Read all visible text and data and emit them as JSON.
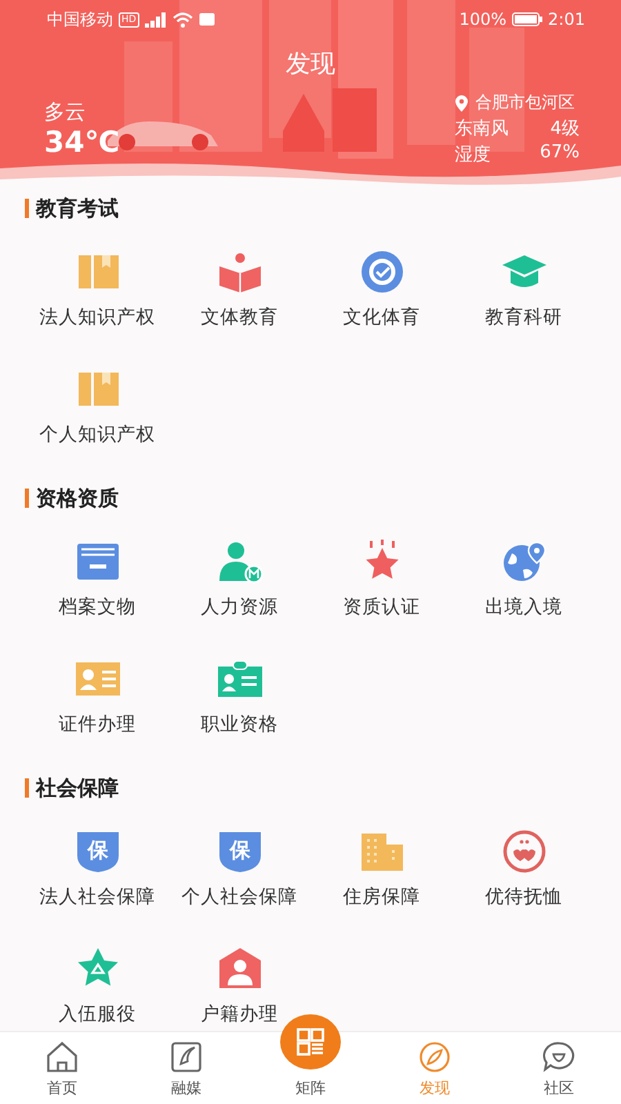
{
  "status_bar": {
    "carrier": "中国移动",
    "network_badge": "HD",
    "battery_text": "100%",
    "time": "2:01"
  },
  "header": {
    "title": "发现",
    "weather": {
      "condition": "多云",
      "temperature": "34℃",
      "location": "合肥市包河区",
      "wind_label": "东南风",
      "wind_value": "4级",
      "humidity_label": "湿度",
      "humidity_value": "67%"
    }
  },
  "sections": [
    {
      "title": "教育考试",
      "items": [
        {
          "label": "法人知识产权"
        },
        {
          "label": "文体教育"
        },
        {
          "label": "文化体育"
        },
        {
          "label": "教育科研"
        },
        {
          "label": "个人知识产权"
        }
      ]
    },
    {
      "title": "资格资质",
      "items": [
        {
          "label": "档案文物"
        },
        {
          "label": "人力资源"
        },
        {
          "label": "资质认证"
        },
        {
          "label": "出境入境"
        },
        {
          "label": "证件办理"
        },
        {
          "label": "职业资格"
        }
      ]
    },
    {
      "title": "社会保障",
      "items": [
        {
          "label": "法人社会保障",
          "badge": "保"
        },
        {
          "label": "个人社会保障",
          "badge": "保"
        },
        {
          "label": "住房保障"
        },
        {
          "label": "优待抚恤"
        },
        {
          "label": "入伍服役"
        },
        {
          "label": "户籍办理"
        }
      ]
    }
  ],
  "tab_bar": [
    {
      "label": "首页",
      "selected": false
    },
    {
      "label": "融媒",
      "selected": false
    },
    {
      "label": "矩阵",
      "selected": false,
      "kind": "raised"
    },
    {
      "label": "发现",
      "selected": true
    },
    {
      "label": "社区",
      "selected": false
    }
  ]
}
